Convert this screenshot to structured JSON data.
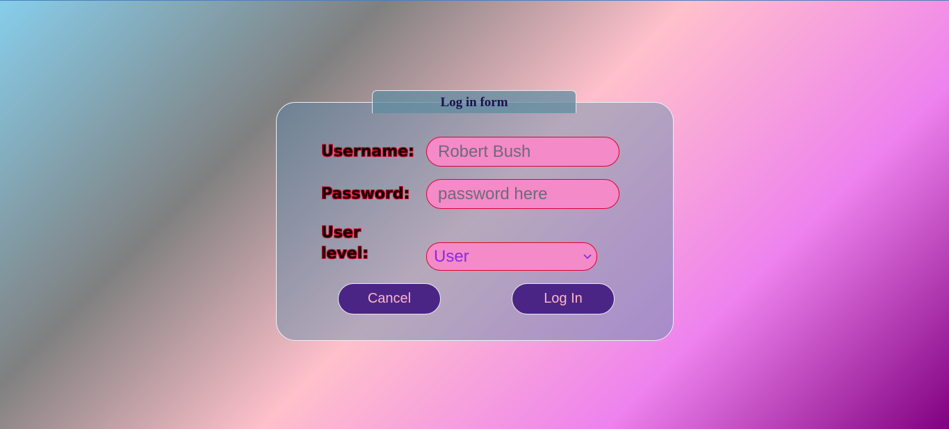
{
  "form": {
    "title": "Log in form",
    "username_label": "Username:",
    "username_value": "Robert Bush",
    "password_label": "Password:",
    "password_placeholder": "password here",
    "level_label": "User level:",
    "level_selected": "User",
    "cancel_label": "Cancel",
    "login_label": "Log In"
  },
  "colors": {
    "input_bg": "#f48ac8",
    "input_border": "#e00030",
    "button_bg": "#4b2585",
    "button_text": "#ffb6c8",
    "select_text": "#8a2be2",
    "title_text": "#1a1050"
  },
  "icons": {
    "select_arrow": "chevron-down-icon"
  }
}
